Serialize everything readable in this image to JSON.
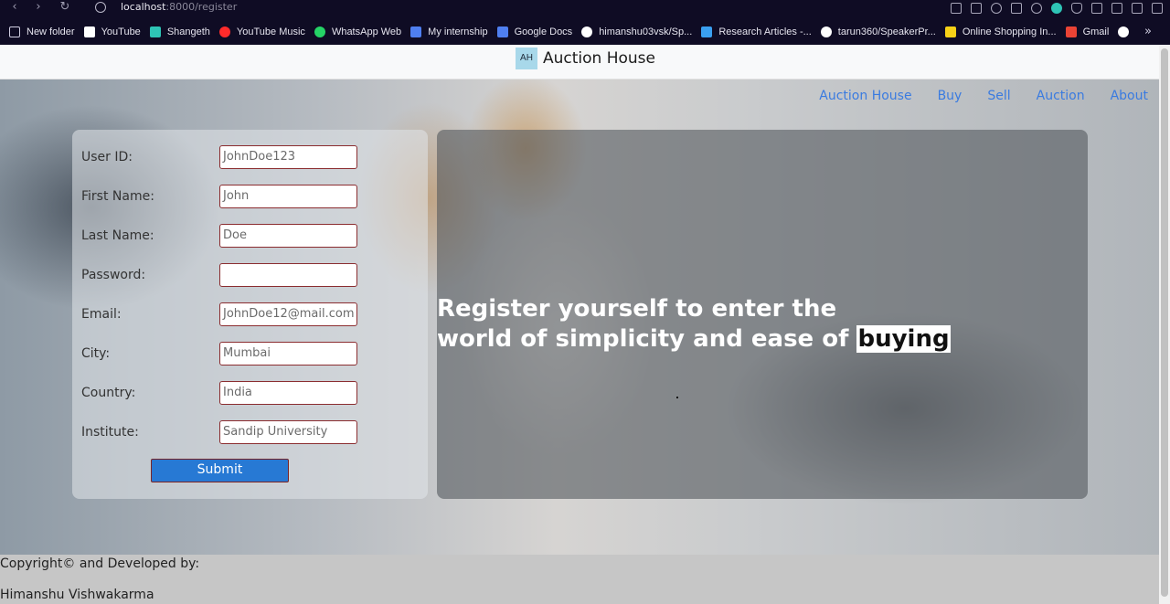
{
  "browser": {
    "url_host": "localhost",
    "url_path": ":8000/register",
    "bookmarks": [
      {
        "label": "New folder",
        "icon": "folder-icon",
        "color": "#cfcde0"
      },
      {
        "label": "YouTube",
        "icon": "document-icon",
        "color": "#ffffff"
      },
      {
        "label": "Shangeth",
        "icon": "shangeth-icon",
        "color": "#2ec4b6"
      },
      {
        "label": "YouTube Music",
        "icon": "youtube-music-icon",
        "color": "#ff2b2b"
      },
      {
        "label": "WhatsApp Web",
        "icon": "whatsapp-icon",
        "color": "#25d366"
      },
      {
        "label": "My internship",
        "icon": "google-forms-icon",
        "color": "#4f7ff0"
      },
      {
        "label": "Google Docs",
        "icon": "google-docs-icon",
        "color": "#4f7ff0"
      },
      {
        "label": "himanshu03vsk/Sp...",
        "icon": "github-icon",
        "color": "#ffffff"
      },
      {
        "label": "Research Articles -...",
        "icon": "cloud-icon",
        "color": "#3aa0f0"
      },
      {
        "label": "tarun360/SpeakerPr...",
        "icon": "github-icon",
        "color": "#ffffff"
      },
      {
        "label": "Online Shopping In...",
        "icon": "flipkart-icon",
        "color": "#f7d117"
      },
      {
        "label": "Gmail",
        "icon": "gmail-icon",
        "color": "#ea4335"
      }
    ],
    "more_label": "»"
  },
  "header": {
    "logo": "AH",
    "title": "Auction House"
  },
  "nav": {
    "items": [
      "Auction House",
      "Buy",
      "Sell",
      "Auction",
      "About"
    ],
    "link_color": "#3a7be0"
  },
  "form": {
    "fields": [
      {
        "label": "User ID:",
        "value": "JohnDoe123"
      },
      {
        "label": "First Name:",
        "value": "John"
      },
      {
        "label": "Last Name:",
        "value": "Doe"
      },
      {
        "label": "Password:",
        "value": ""
      },
      {
        "label": "Email:",
        "value": "JohnDoe12@mail.com"
      },
      {
        "label": "City:",
        "value": "Mumbai"
      },
      {
        "label": "Country:",
        "value": "India"
      },
      {
        "label": "Institute:",
        "value": "Sandip University"
      }
    ],
    "submit_label": "Submit",
    "submit_color": "#2779d4",
    "field_border_color": "#8b2d30"
  },
  "promo": {
    "line1": "Register yourself to enter the",
    "line2": "world of simplicity and ease of ",
    "highlight": "buying"
  },
  "footer": {
    "line1": "Copyright© and Developed by:",
    "line2": "Himanshu Vishwakarma"
  }
}
